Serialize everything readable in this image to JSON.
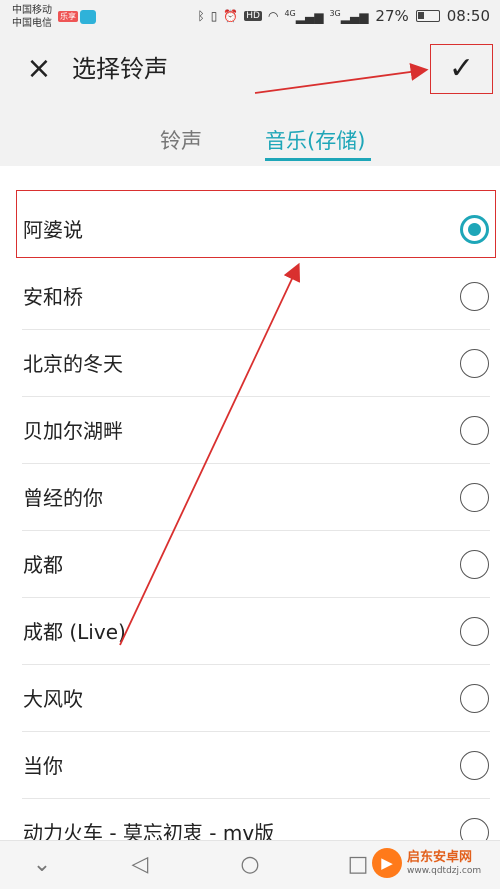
{
  "status_bar": {
    "carrier_1": "中国移动",
    "carrier_2": "中国电信",
    "carrier_badge": "乐享",
    "network_1": "4G",
    "network_2": "3G",
    "battery": "27%",
    "time": "08:50"
  },
  "header": {
    "title": "选择铃声",
    "close_icon": "×",
    "confirm_icon": "✓"
  },
  "tabs": [
    {
      "label": "铃声",
      "active": false
    },
    {
      "label": "音乐(存储)",
      "active": true
    }
  ],
  "songs": [
    {
      "name": "阿婆说",
      "selected": true
    },
    {
      "name": "安和桥",
      "selected": false
    },
    {
      "name": "北京的冬天",
      "selected": false
    },
    {
      "name": "贝加尔湖畔",
      "selected": false
    },
    {
      "name": "曾经的你",
      "selected": false
    },
    {
      "name": "成都",
      "selected": false
    },
    {
      "name": "成都 (Live)",
      "selected": false
    },
    {
      "name": "大风吹",
      "selected": false
    },
    {
      "name": "当你",
      "selected": false
    },
    {
      "name": "动力火车 - 莫忘初衷 - mv版",
      "selected": false
    }
  ],
  "nav": {
    "down_icon": "⌄",
    "back_icon": "◁",
    "home_icon": "○",
    "recent_icon": "□"
  },
  "watermark": {
    "name": "启东安卓网",
    "url": "www.qdtdzj.com"
  },
  "colors": {
    "accent": "#1ea6b8",
    "annotation": "#d9302f"
  }
}
